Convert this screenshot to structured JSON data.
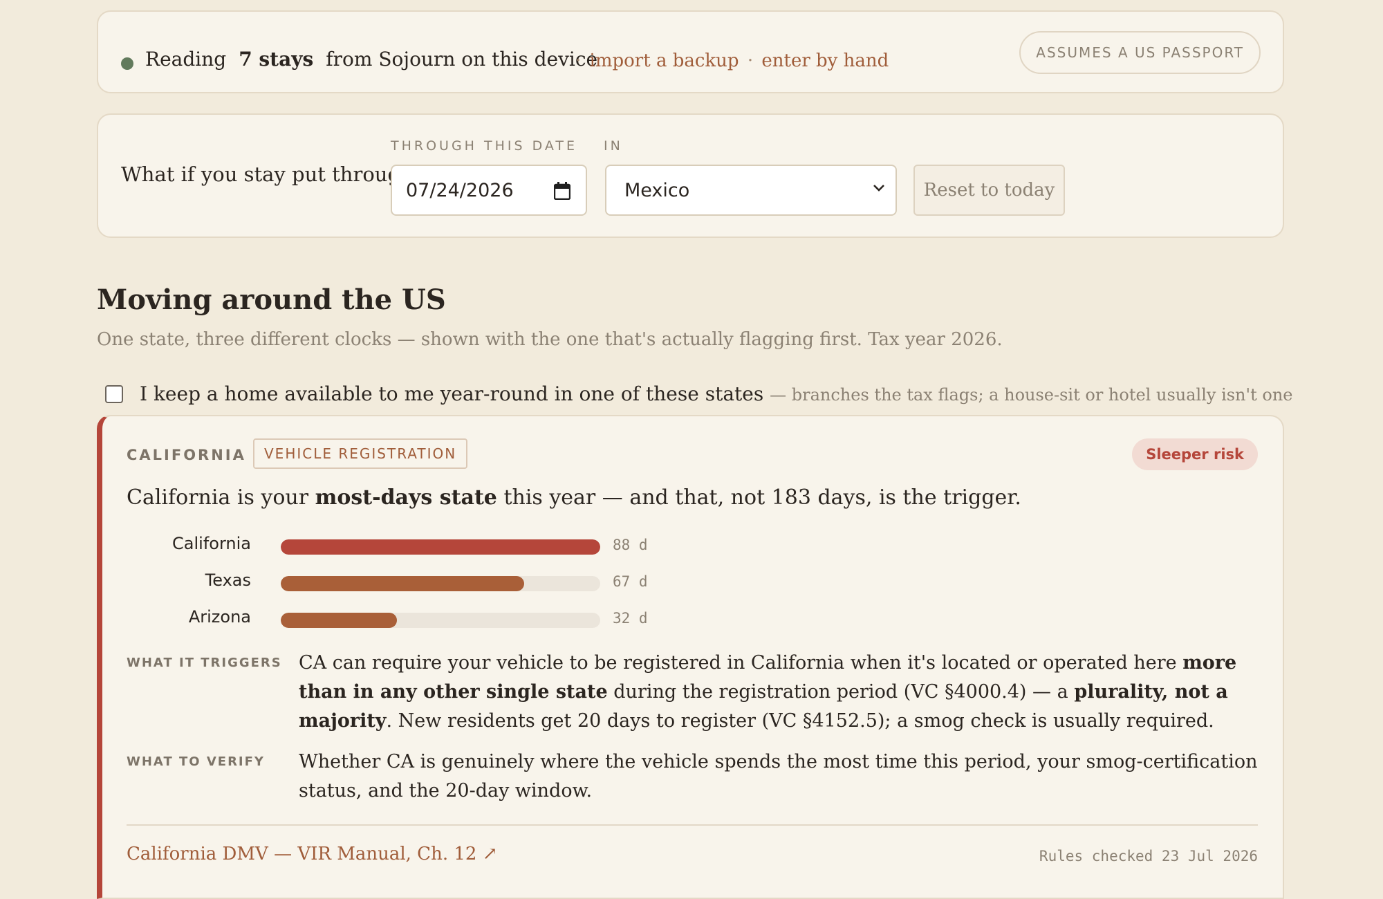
{
  "source": {
    "prefix": "Reading",
    "count": "7 stays",
    "suffix": "from Sojourn on this device",
    "sep1": "·",
    "import_link": "import a backup",
    "sep2": "·",
    "manual_link": "enter by hand",
    "passport_pill": "ASSUMES A US PASSPORT"
  },
  "whatif": {
    "prompt": "What if you stay put through",
    "date_label": "THROUGH THIS DATE",
    "date_value": "07/24/2026",
    "in_label": "IN",
    "country": "Mexico",
    "reset_label": "Reset to today"
  },
  "section": {
    "title": "Moving around the US",
    "subtitle": "One state, three different clocks — shown with the one that's actually flagging first. Tax year 2026."
  },
  "home_option": {
    "label": "I keep a home available to me year-round in one of these states",
    "hint": "— branches the tax flags; a house-sit or hotel usually isn't one",
    "checked": false
  },
  "state_card": {
    "state": "CALIFORNIA",
    "tag": "VEHICLE REGISTRATION",
    "risk": "Sleeper risk",
    "headline_pre": "California is your",
    "headline_bold": "most-days state",
    "headline_post": "this year — and that, not 183 days, is the trigger.",
    "triggers_label": "WHAT IT TRIGGERS",
    "triggers_a": "CA can require your vehicle to be registered in California when it's located or operated here",
    "triggers_b": "more than in any other single state",
    "triggers_c": "during the registration period (VC §4000.4) — a",
    "triggers_d": "plurality, not a majority",
    "triggers_e": ". New residents get 20 days to register (VC §4152.5); a smog check is usually required.",
    "verify_label": "WHAT TO VERIFY",
    "verify_text": "Whether CA is genuinely where the vehicle spends the most time this period, your smog-certification status, and the 20-day window.",
    "source_link": "California DMV — VIR Manual, Ch. 12 ↗",
    "checked": "Rules checked 23 Jul 2026"
  },
  "chart_data": {
    "type": "bar",
    "orientation": "horizontal",
    "categories": [
      "California",
      "Texas",
      "Arizona"
    ],
    "values": [
      88,
      67,
      32
    ],
    "value_labels": [
      "88 d",
      "67 d",
      "32 d"
    ],
    "xlim": [
      0,
      88
    ],
    "colors": [
      "#b5463a",
      "#a95f38",
      "#a95f38"
    ]
  }
}
